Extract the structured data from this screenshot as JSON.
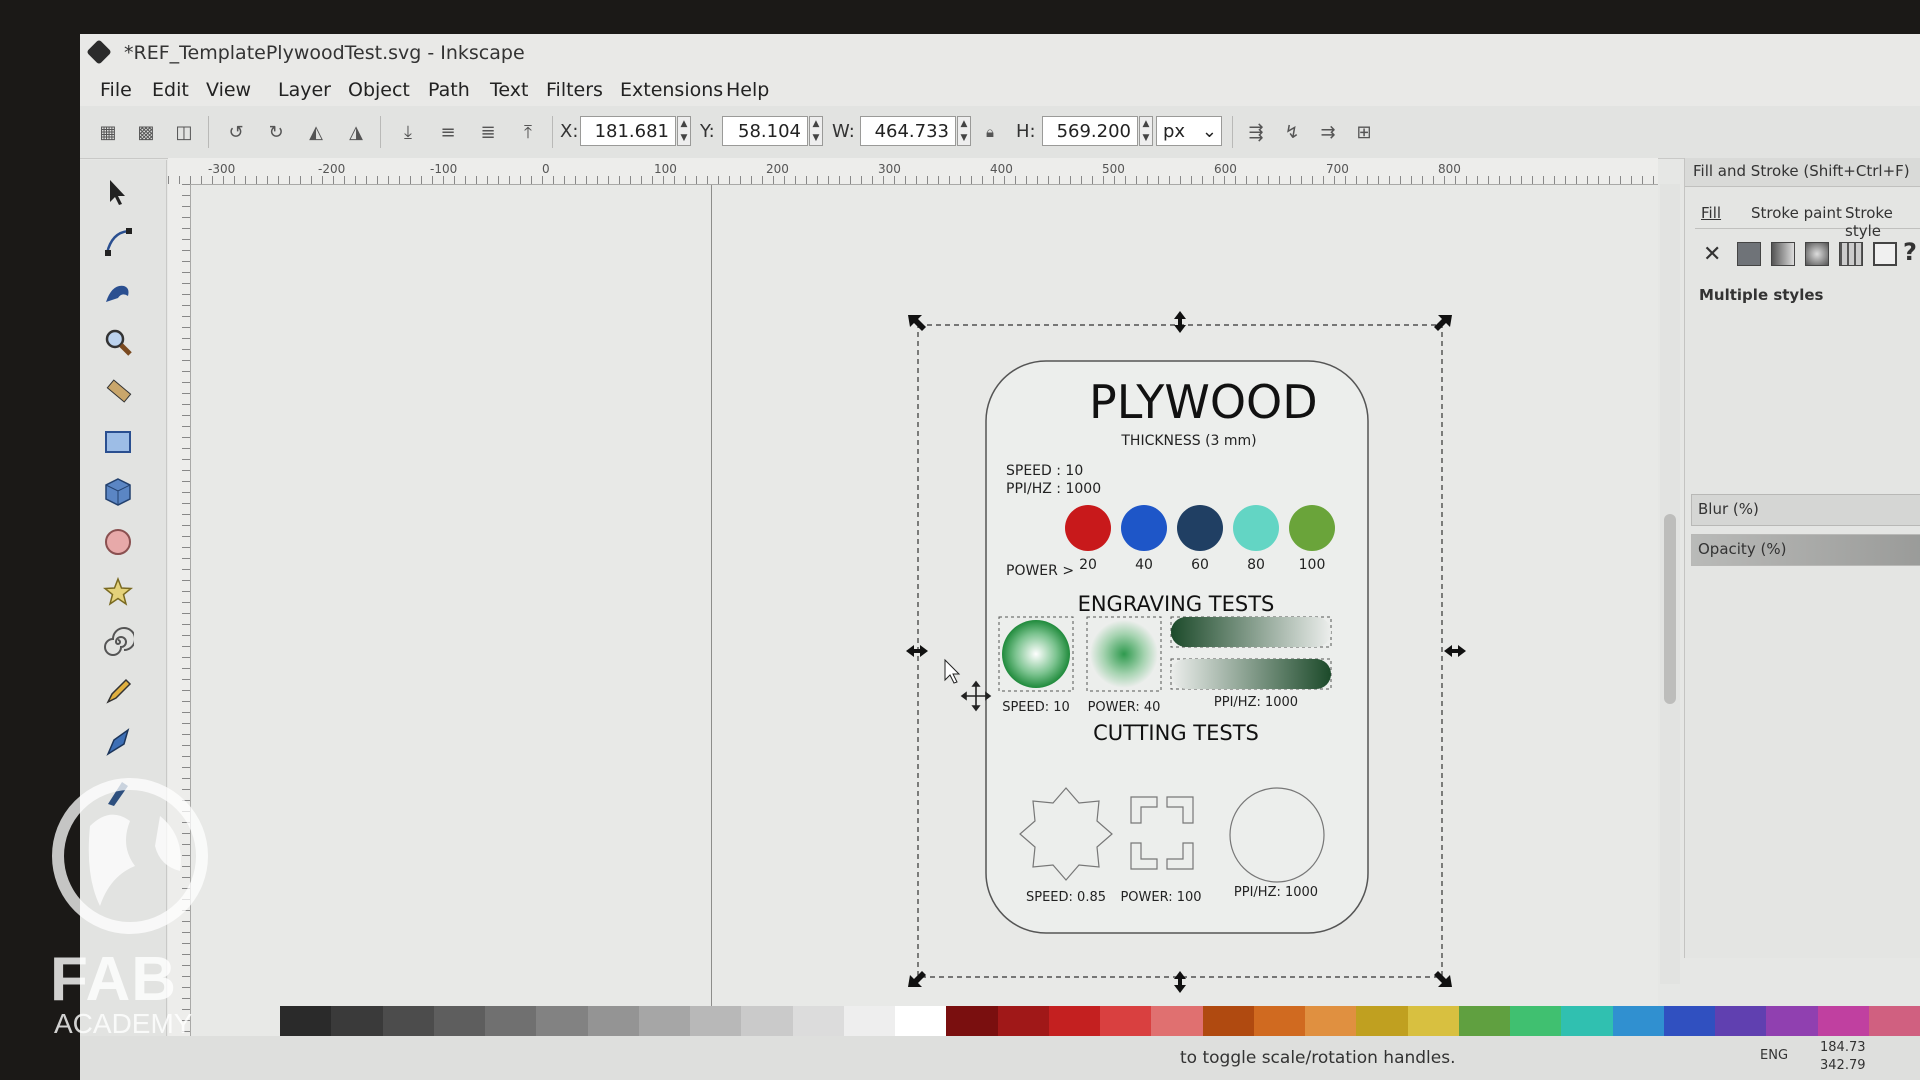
{
  "window": {
    "title": "*REF_TemplatePlywoodTest.svg - Inkscape"
  },
  "menu": [
    "File",
    "Edit",
    "View",
    "Layer",
    "Object",
    "Path",
    "Text",
    "Filters",
    "Extensions",
    "Help"
  ],
  "toolbar": {
    "x_label": "X:",
    "x_value": "181.681",
    "y_label": "Y:",
    "y_value": "58.104",
    "w_label": "W:",
    "w_value": "464.733",
    "h_label": "H:",
    "h_value": "569.200",
    "unit": "px"
  },
  "ruler": {
    "ticks": [
      "-300",
      "-200",
      "-100",
      "0",
      "100",
      "200",
      "300",
      "400",
      "500",
      "600",
      "700",
      "800"
    ]
  },
  "tools": [
    "selector-tool",
    "node-tool",
    "tweak-tool",
    "zoom-tool",
    "measure-tool",
    "rectangle-tool",
    "3d-box-tool",
    "ellipse-tool",
    "star-tool",
    "spiral-tool",
    "pencil-tool",
    "pen-tool",
    "calligraphy-tool"
  ],
  "dialog": {
    "title": "Fill and Stroke (Shift+Ctrl+F)",
    "tabs": [
      "Fill",
      "Stroke paint",
      "Stroke style"
    ],
    "message": "Multiple styles",
    "blur_label": "Blur (%)",
    "opacity_label": "Opacity (%)"
  },
  "card": {
    "title": "PLYWOOD",
    "thickness": "THICKNESS (3 mm)",
    "speed": "SPEED : 10",
    "ppi": "PPI/HZ : 1000",
    "power_label": "POWER  >",
    "power_levels": [
      {
        "label": "20",
        "color": "#c8191b"
      },
      {
        "label": "40",
        "color": "#1e56c8"
      },
      {
        "label": "60",
        "color": "#203f63"
      },
      {
        "label": "80",
        "color": "#63d5c4"
      },
      {
        "label": "100",
        "color": "#6aa43a"
      }
    ],
    "engraving_title": "ENGRAVING TESTS",
    "engraving_labels": [
      "SPEED: 10",
      "POWER: 40",
      "PPI/HZ: 1000"
    ],
    "cutting_title": "CUTTING TESTS",
    "cutting_labels": [
      "SPEED: 0.85",
      "POWER: 100",
      "PPI/HZ: 1000"
    ]
  },
  "status": {
    "message": "to toggle scale/rotation handles.",
    "coord_x": "184.73",
    "coord_y": "342.79",
    "lang": "ENG"
  },
  "palette": [
    "#2a2a2a",
    "#3a3a3a",
    "#4c4c4c",
    "#5e5e5e",
    "#707070",
    "#828282",
    "#949494",
    "#a6a6a6",
    "#b8b8b8",
    "#cacaca",
    "#dcdcdc",
    "#eeeeee",
    "#ffffff",
    "#7a0f0f",
    "#a01818",
    "#c42020",
    "#d94040",
    "#e07070",
    "#b04a10",
    "#d06a20",
    "#e09040",
    "#c0a020",
    "#d8c040",
    "#60a040",
    "#40c070",
    "#30c0b0",
    "#3090d0",
    "#3050c0",
    "#6040b0",
    "#9040b0",
    "#c040a0",
    "#d06080"
  ],
  "logo": {
    "line1": "FAB",
    "line2": "ACADEMY"
  }
}
